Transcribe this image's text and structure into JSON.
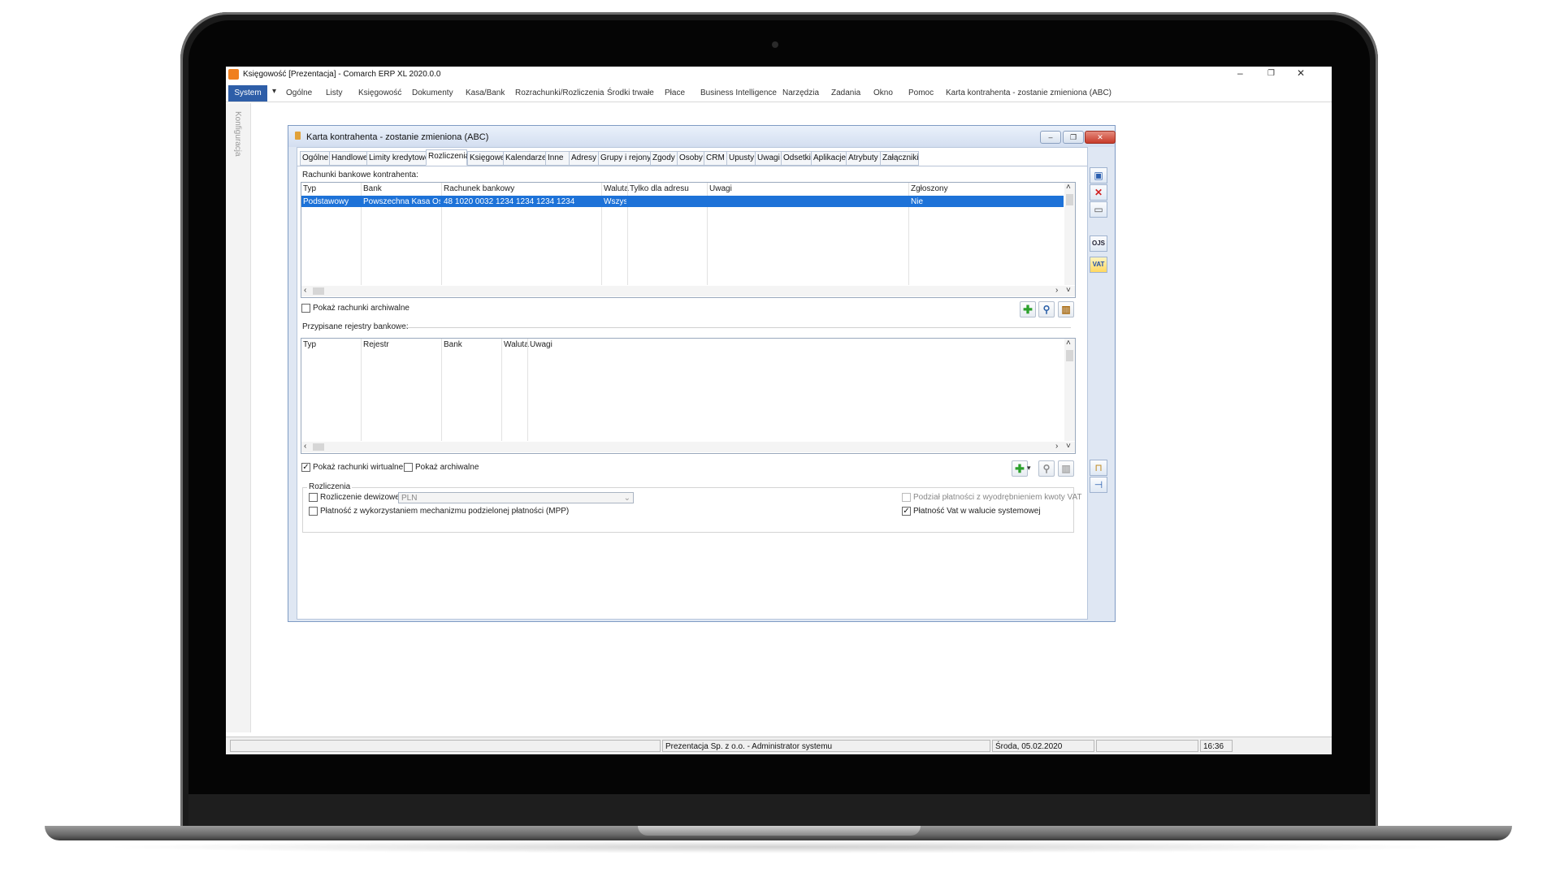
{
  "window": {
    "title": "Księgowość [Prezentacja] - Comarch ERP XL 2020.0.0",
    "minimize": "–",
    "maximize": "❐",
    "close": "✕"
  },
  "menu": {
    "system": "System",
    "quick_access": "▾",
    "items": [
      "Ogólne",
      "Listy",
      "Księgowość",
      "Dokumenty",
      "Kasa/Bank",
      "Rozrachunki/Rozliczenia",
      "Środki trwałe",
      "Płace",
      "Business Intelligence",
      "Narzędzia",
      "Zadania",
      "Okno",
      "Pomoc",
      "Karta kontrahenta - zostanie zmieniona (ABC)"
    ]
  },
  "sidebar": {
    "label": "Konfiguracja"
  },
  "dialog": {
    "title": "Karta kontrahenta - zostanie zmieniona (ABC)",
    "tabs": [
      "Ogólne",
      "Handlowe",
      "Limity kredytowe",
      "Rozliczenia",
      "Księgowe",
      "Kalendarze",
      "Inne",
      "Adresy",
      "Grupy i rejony",
      "Zgody",
      "Osoby",
      "CRM",
      "Upusty",
      "Uwagi",
      "Odsetki",
      "Aplikacje",
      "Atrybuty",
      "Załączniki"
    ],
    "active_tab": "Rozliczenia",
    "bank_accounts": {
      "label": "Rachunki bankowe kontrahenta:",
      "columns": [
        "Typ",
        "Bank",
        "Rachunek bankowy",
        "Waluta",
        "Tylko dla adresu",
        "Uwagi",
        "Zgłoszony"
      ],
      "rows": [
        [
          "Podstawowy",
          "Powszechna Kasa Oszcz",
          "48 1020 0032 1234 1234 1234 1234",
          "Wszyst",
          "",
          "",
          "Nie"
        ]
      ],
      "show_archived_label": "Pokaż rachunki archiwalne",
      "show_archived": false
    },
    "bank_registers": {
      "label": "Przypisane rejestry bankowe:",
      "columns": [
        "Typ",
        "Rejestr",
        "Bank",
        "Waluta",
        "Uwagi"
      ],
      "rows": [],
      "show_virtual_label": "Pokaż rachunki wirtualne",
      "show_virtual": true,
      "show_archived_label": "Pokaż archiwalne",
      "show_archived": false
    },
    "settlements": {
      "group_label": "Rozliczenia",
      "fx_label": "Rozliczenie dewizowe",
      "fx_checked": false,
      "currency": "PLN",
      "mpp_label": "Płatność z wykorzystaniem mechanizmu podzielonej płatności (MPP)",
      "mpp_checked": false,
      "split_vat_label": "Podział płatności z wyodrębnieniem kwoty VAT",
      "split_vat_checked": false,
      "vat_system_currency_label": "Płatność Vat w walucie systemowej",
      "vat_system_currency_checked": true
    },
    "right_toolbar": {
      "ojs": "OJS",
      "vat": "VAT"
    }
  },
  "statusbar": {
    "company_user": "Prezentacja Sp. z o.o. - Administrator systemu",
    "date": "Środa, 05.02.2020",
    "time": "16:36"
  },
  "colors": {
    "accent": "#2e5ea8",
    "selection": "#1d72d8",
    "dialog_bg": "#dfe7f3"
  }
}
